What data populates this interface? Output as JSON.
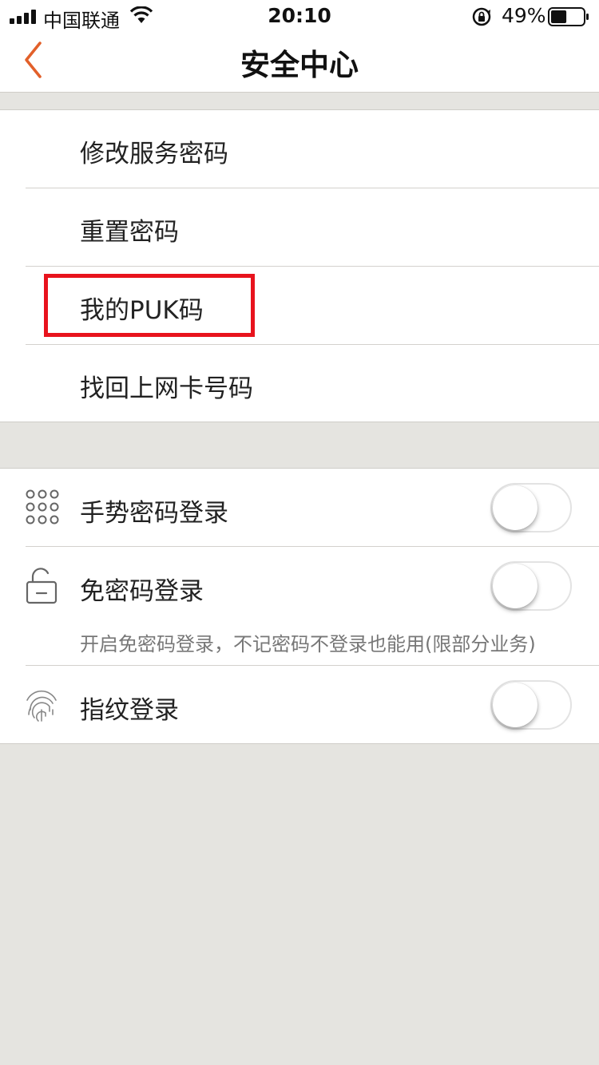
{
  "status_bar": {
    "carrier": "中国联通",
    "time": "20:10",
    "battery_percent": "49%",
    "battery_level": 0.49,
    "icons": [
      "signal-icon",
      "wifi-icon",
      "rotation-lock-icon",
      "battery-icon"
    ]
  },
  "nav": {
    "title": "安全中心",
    "back_icon": "chevron-left-icon",
    "accent_color": "#e2602a"
  },
  "menu": {
    "items": [
      {
        "label": "修改服务密码"
      },
      {
        "label": "重置密码"
      },
      {
        "label": "我的PUK码",
        "highlighted": true
      },
      {
        "label": "找回上网卡号码"
      }
    ],
    "highlight_color": "#e8131d"
  },
  "login_settings": {
    "items": [
      {
        "label": "手势密码登录",
        "icon": "gesture-grid-icon",
        "enabled": false
      },
      {
        "label": "免密码登录",
        "icon": "unlock-icon",
        "enabled": false,
        "hint": "开启免密码登录，不记密码不登录也能用(限部分业务)"
      },
      {
        "label": "指纹登录",
        "icon": "fingerprint-icon",
        "enabled": false
      }
    ]
  }
}
